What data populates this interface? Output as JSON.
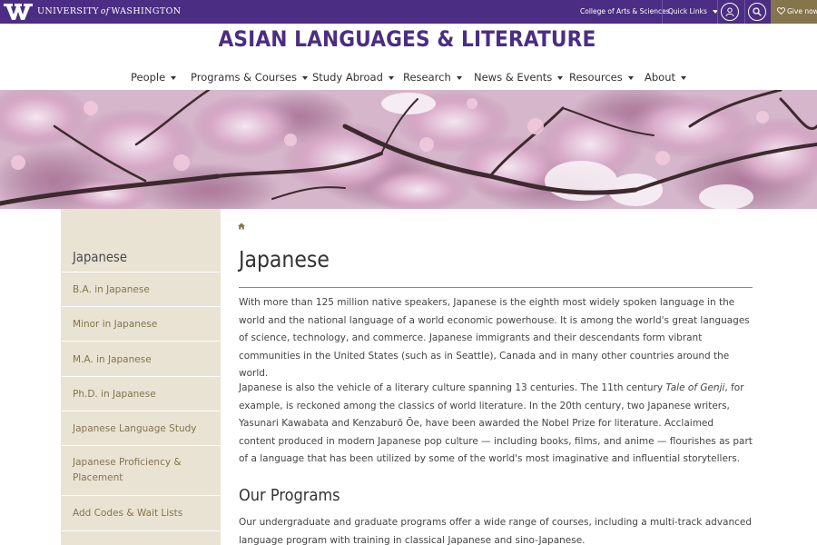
{
  "topbar": {
    "university_pre": "UNIVERSITY",
    "university_of": "of",
    "university_post": "WASHINGTON",
    "college_link": "College of Arts & Sciences",
    "quick_links": "Quick Links",
    "give_now": "Give now"
  },
  "site_title": "ASIAN LANGUAGES & LITERATURE",
  "nav": [
    {
      "label": "People"
    },
    {
      "label": "Programs & Courses"
    },
    {
      "label": "Study Abroad"
    },
    {
      "label": "Research"
    },
    {
      "label": "News & Events"
    },
    {
      "label": "Resources"
    },
    {
      "label": "About"
    }
  ],
  "sidebar": {
    "heading": "Japanese",
    "items": [
      {
        "label": "B.A. in Japanese"
      },
      {
        "label": "Minor in Japanese"
      },
      {
        "label": "M.A. in Japanese"
      },
      {
        "label": "Ph.D. in Japanese"
      },
      {
        "label": "Japanese Language Study"
      },
      {
        "label": "Japanese Proficiency & Placement"
      },
      {
        "label": "Add Codes & Wait Lists"
      }
    ]
  },
  "main": {
    "title": "Japanese",
    "para1": "With more than 125 million native speakers, Japanese is the eighth most widely spoken language in the world and the national language of a world economic powerhouse. It is among the world's great languages of science, technology, and commerce. Japanese immigrants and their descendants form vibrant communities in the United States (such as in Seattle), Canada and in many other countries around the world.",
    "para2_a": "Japanese is also the vehicle of a literary culture spanning 13 centuries. The 11th century ",
    "para2_italic": "Tale of Genji",
    "para2_b": ", for example, is reckoned among the classics of world literature. In the 20th century, two Japanese writers, Yasunari Kawabata and Kenzaburō Ōe, have been awarded the Nobel Prize for literature. Acclaimed content produced in modern Japanese pop culture — including books, films, and anime — flourishes as part of a language that has been utilized by some of the world's most imaginative and influential storytellers.",
    "programs_heading": "Our Programs",
    "para3": "Our undergraduate and graduate programs offer a wide range of courses, including a multi-track advanced language program with training in classical Japanese and sino-Japanese."
  },
  "colors": {
    "uw_purple": "#4b2e83",
    "uw_gold": "#85754d",
    "sidebar_bg": "#e8e3d3"
  }
}
